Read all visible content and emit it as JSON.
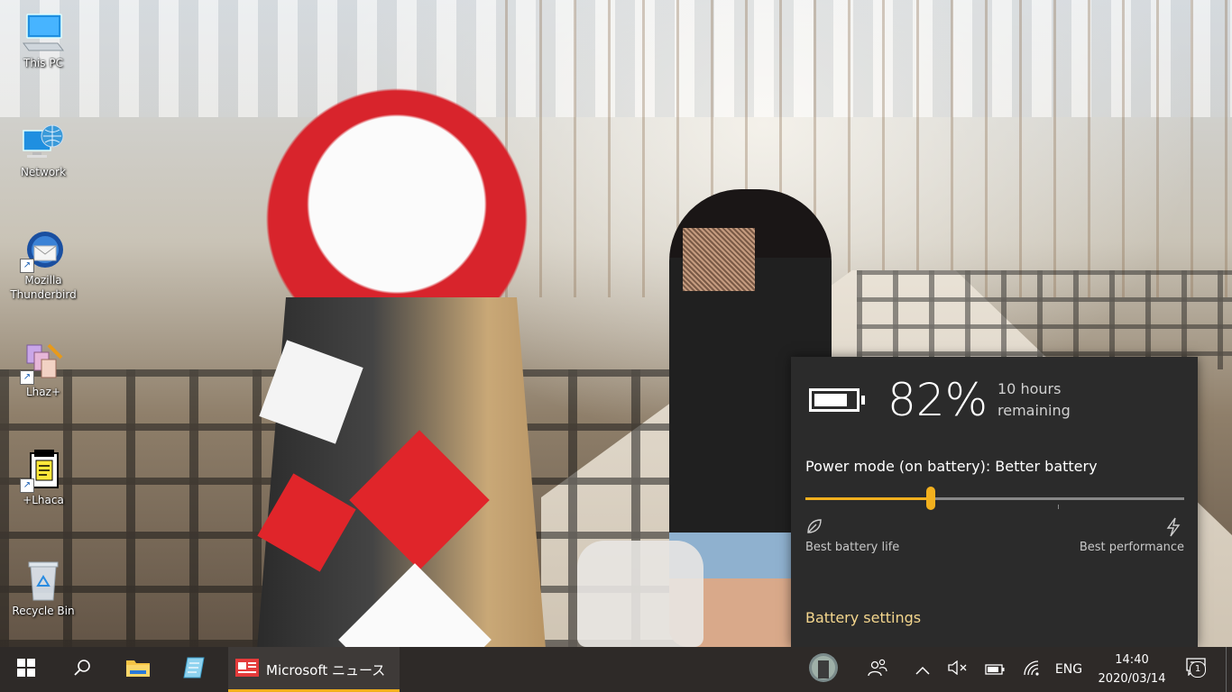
{
  "desktop": {
    "icons": [
      {
        "label": "This PC"
      },
      {
        "label": "Network"
      },
      {
        "label": "Mozilla Thunderbird"
      },
      {
        "label": "Lhaz+"
      },
      {
        "label": "+Lhaca"
      },
      {
        "label": "Recycle Bin"
      }
    ]
  },
  "battery_flyout": {
    "percent_text": "82%",
    "percent_value": 82,
    "remaining_text": "10 hours remaining",
    "power_mode_text": "Power mode (on battery): Better battery",
    "slider_position": 0.33,
    "slider_left_label": "Best battery life",
    "slider_right_label": "Best performance",
    "settings_link": "Battery settings",
    "accent_color": "#f2b01e",
    "link_color": "#f5d78e"
  },
  "taskbar": {
    "start_icon": "windows-logo-icon",
    "search_icon": "search-icon",
    "pinned": [
      "file-explorer-icon",
      "notepad-icon"
    ],
    "running_app": {
      "label": "Microsoft ニュース",
      "icon": "news-icon"
    },
    "tray": {
      "people_icon": "people-icon",
      "chevron_icon": "chevron-up-icon",
      "volume_icon": "volume-muted-icon",
      "battery_icon": "battery-icon",
      "wifi_icon": "wifi-icon",
      "language": "ENG"
    },
    "clock": {
      "time": "14:40",
      "date": "2020/03/14"
    },
    "notifications": {
      "count": "1"
    }
  }
}
